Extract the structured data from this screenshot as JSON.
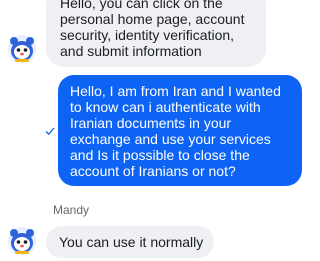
{
  "conversation": {
    "messages": [
      {
        "direction": "incoming",
        "lines": [
          "Hello, you can click on the",
          "personal home page, account",
          "security, identity verification,",
          "and submit information"
        ]
      },
      {
        "direction": "outgoing",
        "status_icon": "sent-check-icon",
        "lines": [
          "Hello, I am from Iran and I wanted",
          "to know  can i authenticate with",
          "Iranian documents in your",
          "exchange and use your services",
          "and Is it possible to close the",
          "account of Iranians or not?"
        ]
      },
      {
        "direction": "incoming",
        "sender": "Mandy",
        "lines": [
          "You can use it normally"
        ]
      }
    ]
  },
  "colors": {
    "incoming_bubble": "#eef0f3",
    "outgoing_bubble": "#0d63f3",
    "check": "#0d63f3"
  }
}
